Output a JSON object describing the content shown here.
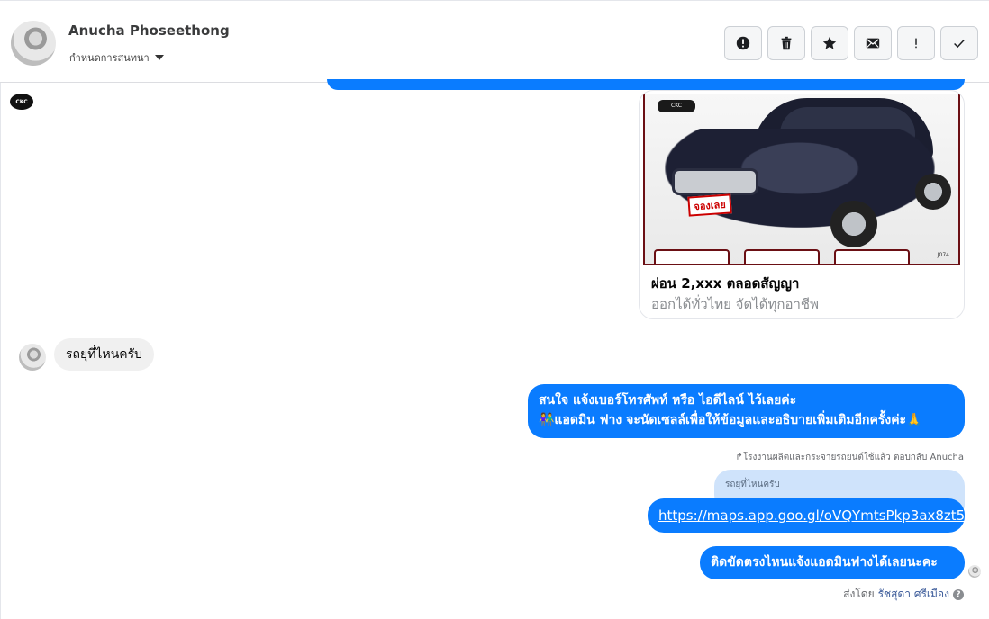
{
  "header": {
    "contact_name": "Anucha Phoseethong",
    "assign_label": "กำหนดการสนทนา",
    "toolbar": [
      {
        "name": "spam-button",
        "icon": "alert-circle-icon",
        "label": "!"
      },
      {
        "name": "delete-button",
        "icon": "trash-icon",
        "label": ""
      },
      {
        "name": "star-button",
        "icon": "star-icon",
        "label": ""
      },
      {
        "name": "mark-unread-button",
        "icon": "envelope-icon",
        "label": ""
      },
      {
        "name": "follow-up-button",
        "icon": "exclamation-icon",
        "label": "!"
      },
      {
        "name": "done-button",
        "icon": "check-icon",
        "label": ""
      }
    ]
  },
  "messages": {
    "card": {
      "title": "ผ่อน 2,xxx ตลอดสัญญา",
      "subtitle": "ออกได้ทั่วไทย จัดได้ทุกอาชีพ"
    },
    "incoming_1": "รถยุที่ไหนครับ",
    "outgoing_1_line1": "สนใจ แจ้งเบอร์โทรศัพท์ หรือ ไอดีไลน์  ไว้เลยค่ะ",
    "outgoing_1_line2": "👫แอดมิน ฟาง จะนัดเซลล์เพื่อให้ข้อมูลและอธิบายเพิ่มเติมอีกครั้งค่ะ🙏",
    "reply_note": "↱โรงงานผลิตและกระจายรถยนต์ใช้แล้ว ตอบกลับ Anucha",
    "quoted_text": "รถยุที่ไหนครับ",
    "outgoing_link": "https://maps.app.goo.gl/oVQYmtsPkp3ax8zt5",
    "outgoing_2": "ติดขัดตรงไหนแจ้งแอดมินฟางได้เลยนะคะ",
    "sent_by_prefix": "ส่งโดย",
    "sent_by_name": "รัชสุดา ศรีเมือง"
  },
  "colors": {
    "accent": "#0a7cff",
    "incoming_bubble": "#f0f0f0",
    "quoted_bubble": "#cfe3fb"
  }
}
